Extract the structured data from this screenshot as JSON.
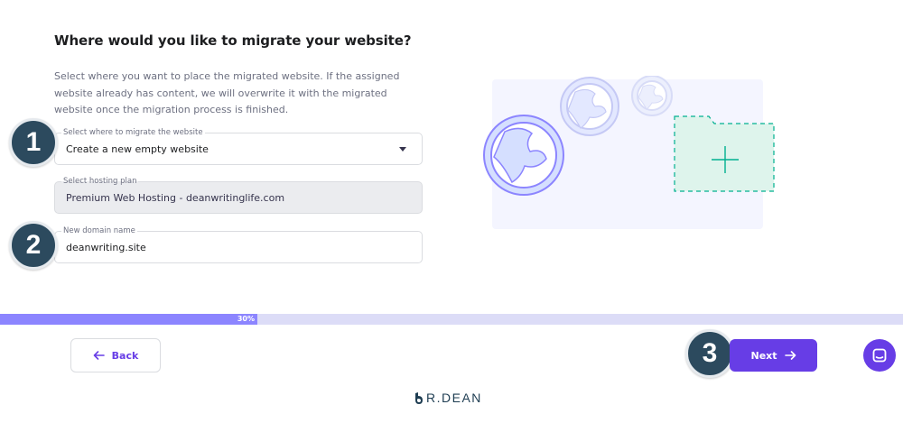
{
  "page": {
    "title": "Where would you like to migrate your website?",
    "description": "Select where you want to place the migrated website. If the assigned website already has content, we will overwrite it with the migrated website once the migration process is finished."
  },
  "fields": {
    "migrate_location": {
      "label": "Select where to migrate the website",
      "value": "Create a new empty website"
    },
    "hosting_plan": {
      "label": "Select hosting plan",
      "value": "Premium Web Hosting - deanwritinglife.com"
    },
    "domain_name": {
      "label": "New domain name",
      "value": "deanwriting.site"
    }
  },
  "annotations": {
    "step1": "1",
    "step2": "2",
    "step3": "3"
  },
  "progress": {
    "percent": 30,
    "label": "30%"
  },
  "footer": {
    "back_label": "Back",
    "next_label": "Next"
  },
  "logo": {
    "text": "R.DEAN"
  },
  "colors": {
    "accent": "#673de6",
    "progress_fill": "#8c85ff",
    "progress_track": "#dcdcf7",
    "badge": "#2c4a5e"
  },
  "icons": {
    "back": "arrow-left-icon",
    "next": "arrow-right-icon",
    "chat": "chat-icon",
    "dropdown": "caret-down-icon"
  }
}
